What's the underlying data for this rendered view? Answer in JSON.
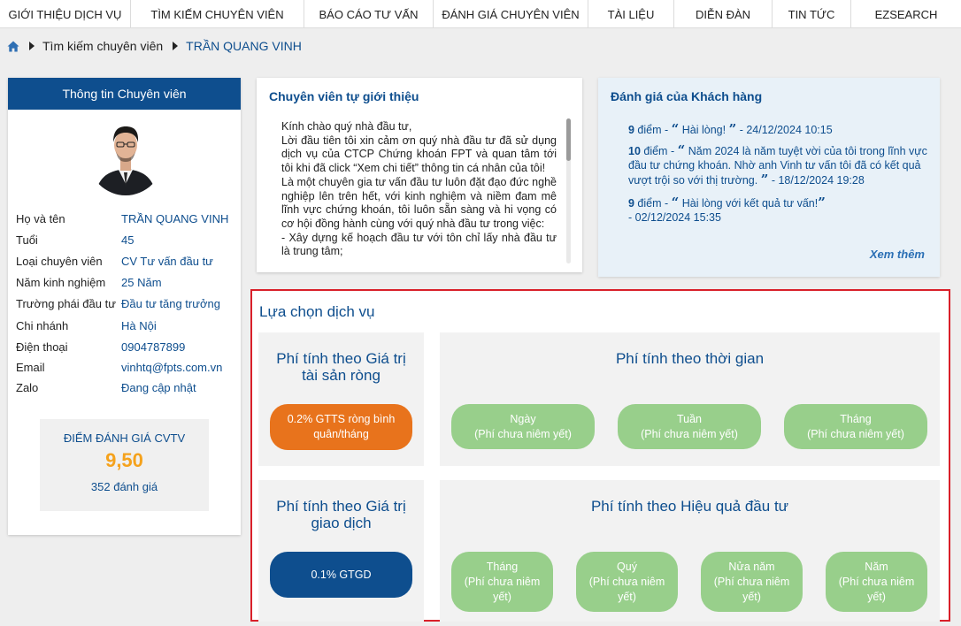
{
  "nav": [
    "GIỚI THIỆU DỊCH VỤ",
    "TÌM KIẾM CHUYÊN VIÊN",
    "BÁO CÁO TƯ VẤN",
    "ĐÁNH GIÁ CHUYÊN VIÊN",
    "TÀI LIỆU",
    "DIỄN ĐÀN",
    "TIN TỨC",
    "EZSEARCH"
  ],
  "breadcrumb": {
    "home_icon": "home-icon",
    "items": [
      "Tìm kiếm chuyên viên",
      "TRẦN QUANG VINH"
    ]
  },
  "profile": {
    "header": "Thông tin Chuyên viên",
    "rows": [
      {
        "label": "Họ và tên",
        "value": "TRẦN QUANG VINH"
      },
      {
        "label": "Tuổi",
        "value": "45"
      },
      {
        "label": "Loại chuyên viên",
        "value": "CV Tư vấn đầu tư"
      },
      {
        "label": "Năm kinh nghiệm",
        "value": "25 Năm"
      },
      {
        "label": "Trường phái đầu tư",
        "value": "Đầu tư tăng trưởng"
      },
      {
        "label": "Chi nhánh",
        "value": "Hà Nội"
      },
      {
        "label": "Điện thoại",
        "value": "0904787899"
      },
      {
        "label": "Email",
        "value": "vinhtq@fpts.com.vn"
      },
      {
        "label": "Zalo",
        "value": "Đang cập nhật"
      }
    ],
    "score_title": "ĐIỂM ĐÁNH GIÁ CVTV",
    "score_value": "9,50",
    "score_count": "352 đánh giá"
  },
  "intro": {
    "title": "Chuyên viên tự giới thiệu",
    "paragraphs": [
      "Kính chào quý nhà đầu tư,",
      "Lời đầu tiên tôi xin cảm ơn quý nhà đầu tư đã sử dụng dịch vụ của CTCP Chứng khoán FPT và quan tâm tới tôi khi đã click “Xem chi tiết” thông tin cá nhân của tôi!",
      "Là một chuyên gia tư vấn đầu tư luôn đặt đạo đức nghề nghiệp lên trên hết, với kinh nghiệm và niềm đam mê lĩnh vực chứng khoán, tôi luôn sẵn sàng và hi vọng có cơ hội đồng hành cùng với quý nhà đầu tư trong việc:",
      "- Xây dựng kế hoạch đầu tư với tôn chỉ lấy nhà đầu tư là trung tâm;"
    ]
  },
  "reviews": {
    "title": "Đánh giá của Khách hàng",
    "items": [
      {
        "score": "9",
        "unit": " điểm - ",
        "text": "Hài lòng!",
        "date": " - 24/12/2024 10:15"
      },
      {
        "score": "10",
        "unit": " điểm - ",
        "text": "Năm 2024 là năm tuyệt vời của tôi trong lĩnh vực đầu tư chứng khoán. Nhờ anh Vinh tư vấn tôi đã có kết quả vượt trội so với thị trường.",
        "date": " - 18/12/2024 19:28"
      },
      {
        "score": "9",
        "unit": " điểm - ",
        "text": "Hài lòng với kết quả tư vấn!",
        "date": " - 02/12/2024 15:35"
      }
    ],
    "more": "Xem thêm"
  },
  "services": {
    "title": "Lựa chọn dịch vụ",
    "nav_value": {
      "title": "Phí tính theo Giá trị tài sản ròng",
      "button": "0.2% GTTS ròng bình quân/tháng"
    },
    "time": {
      "title": "Phí tính theo thời gian",
      "options": [
        {
          "name": "Ngày",
          "note": "(Phí chưa niêm yết)"
        },
        {
          "name": "Tuần",
          "note": "(Phí chưa niêm yết)"
        },
        {
          "name": "Tháng",
          "note": "(Phí chưa niêm yết)"
        }
      ]
    },
    "transaction": {
      "title": "Phí tính theo Giá trị giao dịch",
      "button": "0.1% GTGD"
    },
    "performance": {
      "title": "Phí tính theo Hiệu quả đầu tư",
      "options": [
        {
          "name": "Tháng",
          "note": "(Phí chưa niêm yết)"
        },
        {
          "name": "Quý",
          "note": "(Phí chưa niêm yết)"
        },
        {
          "name": "Nửa năm",
          "note": "(Phí chưa niêm yết)"
        },
        {
          "name": "Năm",
          "note": "(Phí chưa niêm yết)"
        }
      ]
    }
  },
  "colors": {
    "primary": "#0e4e8e",
    "accent_orange": "#e8731c",
    "score": "#f5a21c",
    "green_option": "#98cf8b",
    "highlight_border": "#d9202a"
  }
}
